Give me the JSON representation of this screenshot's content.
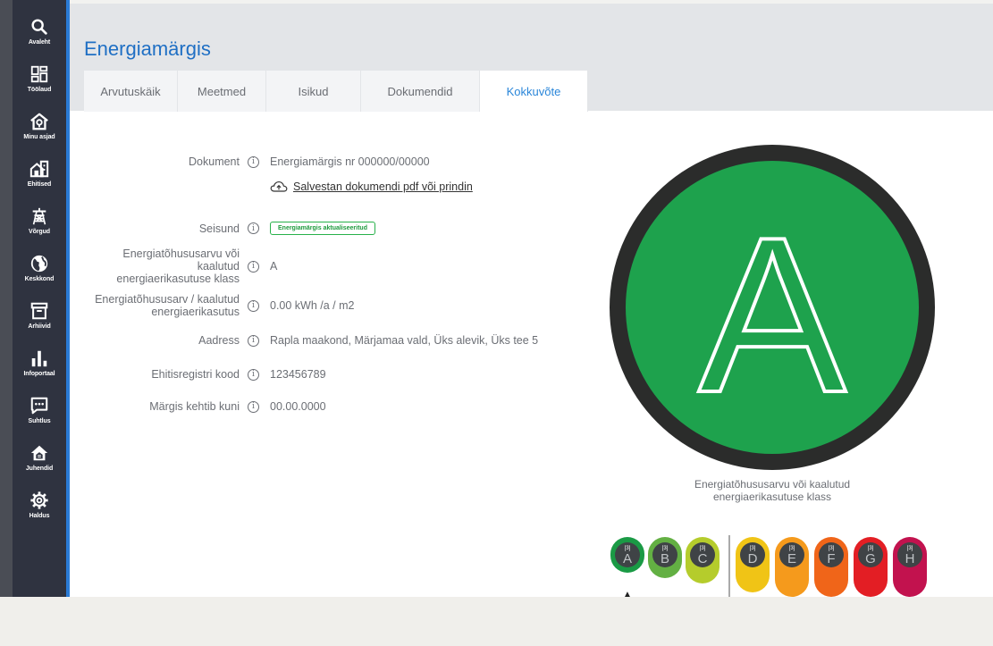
{
  "nav": [
    {
      "label": "Avaleht",
      "icon": "search-icon"
    },
    {
      "label": "Töölaud",
      "icon": "dashboard-icon"
    },
    {
      "label": "Minu asjad",
      "icon": "home-pin-icon"
    },
    {
      "label": "Ehitised",
      "icon": "building-icon"
    },
    {
      "label": "Võrgud",
      "icon": "power-tower-icon"
    },
    {
      "label": "Keskkond",
      "icon": "globe-icon"
    },
    {
      "label": "Arhiivid",
      "icon": "archive-icon"
    },
    {
      "label": "Infoportaal",
      "icon": "bar-chart-icon"
    },
    {
      "label": "Suhtlus",
      "icon": "chat-icon"
    },
    {
      "label": "Juhendid",
      "icon": "guide-house-icon"
    },
    {
      "label": "Haldus",
      "icon": "gear-icon"
    }
  ],
  "page": {
    "title": "Energiamärgis",
    "tabs": [
      "Arvutuskäik",
      "Meetmed",
      "Isikud",
      "Dokumendid",
      "Kokkuvõte"
    ],
    "active_tab": "Kokkuvõte"
  },
  "details": {
    "document_label": "Dokument",
    "document_value": "Energiamärgis nr 000000/00000",
    "pdf_link": "Salvestan dokumendi pdf või prindin",
    "status_label": "Seisund",
    "status_value": "Energiamärgis aktualiseeritud",
    "class_label": "Energiatõhususarvu või kaalutud energiaerikasutuse klass",
    "class_value": "A",
    "number_label": "Energiatõhususarv / kaalutud energiaerikasutus",
    "number_value": "0.00 kWh /a / m2",
    "address_label": "Aadress",
    "address_value": "Rapla maakond, Märjamaa vald, Üks alevik, Üks tee 5",
    "registry_label": "Ehitisregistri kood",
    "registry_value": "123456789",
    "valid_label": "Märgis kehtib kuni",
    "valid_value": "00.00.0000",
    "info_icon": "i"
  },
  "badge": {
    "letter": "A",
    "caption": "Energiatõhususarvu või kaalutud energiaerikasutuse klass",
    "color": "#1ea24d"
  },
  "scale": {
    "selected": "A",
    "marker": "▲",
    "classes": [
      {
        "letter": "A",
        "tag": "[3]",
        "color": "#1a9a45"
      },
      {
        "letter": "B",
        "tag": "[3]",
        "color": "#63b043"
      },
      {
        "letter": "C",
        "tag": "[3]",
        "color": "#b5cc2c"
      },
      {
        "letter": "D",
        "tag": "[3]",
        "color": "#f0c416"
      },
      {
        "letter": "E",
        "tag": "[3]",
        "color": "#f59a1c"
      },
      {
        "letter": "F",
        "tag": "[3]",
        "color": "#f06519"
      },
      {
        "letter": "G",
        "tag": "[3]",
        "color": "#e31e24"
      },
      {
        "letter": "H",
        "tag": "[3]",
        "color": "#c2124e"
      }
    ]
  }
}
